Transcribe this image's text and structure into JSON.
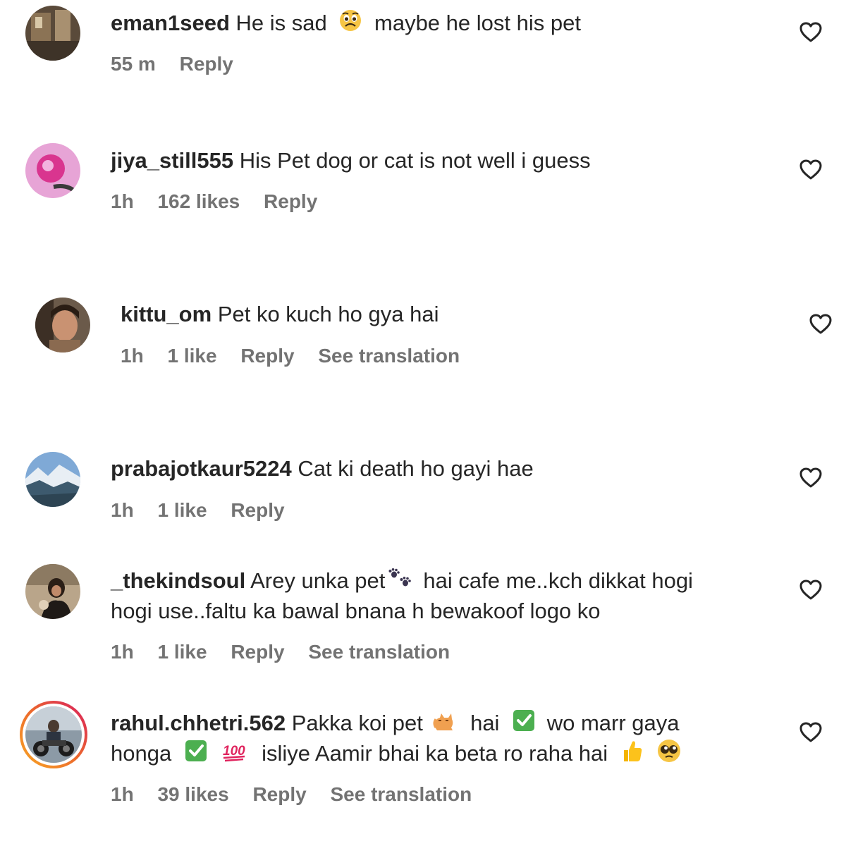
{
  "comments": [
    {
      "username": "eman1seed",
      "text_a": "He is sad",
      "text_b": "maybe he lost his pet",
      "time": "55 m",
      "reply": "Reply",
      "emoji_a": "worried-face-emoji"
    },
    {
      "username": "jiya_still555",
      "text": "His Pet dog or cat is not well i guess",
      "time": "1h",
      "likes": "162 likes",
      "reply": "Reply"
    },
    {
      "username": "kittu_om",
      "text": "Pet ko kuch ho gya hai",
      "time": "1h",
      "likes": "1 like",
      "reply": "Reply",
      "translate": "See translation"
    },
    {
      "username": "prabajotkaur5224",
      "text": "Cat ki death ho gayi hae",
      "time": "1h",
      "likes": "1 like",
      "reply": "Reply"
    },
    {
      "username": "_thekindsoul",
      "line1_a": "Arey unka pet",
      "line1_b": "hai cafe me..kch dikkat hogi",
      "line2": "hogi use..faltu ka bawal bnana h bewakoof logo ko",
      "time": "1h",
      "likes": "1 like",
      "reply": "Reply",
      "translate": "See translation",
      "emoji": "paw-prints-emoji"
    },
    {
      "username": "rahul.chhetri.562",
      "line1_a": "Pakka koi pet",
      "line1_b": "hai",
      "line1_c": "wo marr gaya",
      "line2_a": "honga",
      "line2_b": "isliye Aamir bhai ka beta ro raha hai",
      "time": "1h",
      "likes": "39 likes",
      "reply": "Reply",
      "translate": "See translation",
      "emojis": [
        "cat-emoji",
        "check-mark-emoji",
        "check-mark-emoji",
        "hundred-points-emoji",
        "thumbs-up-emoji",
        "pleading-face-emoji"
      ]
    }
  ],
  "colors": {
    "text": "#262626",
    "meta": "#737373",
    "story_ring_start": "#f9a825",
    "story_ring_end": "#d81b60",
    "check_green": "#4caf50"
  }
}
